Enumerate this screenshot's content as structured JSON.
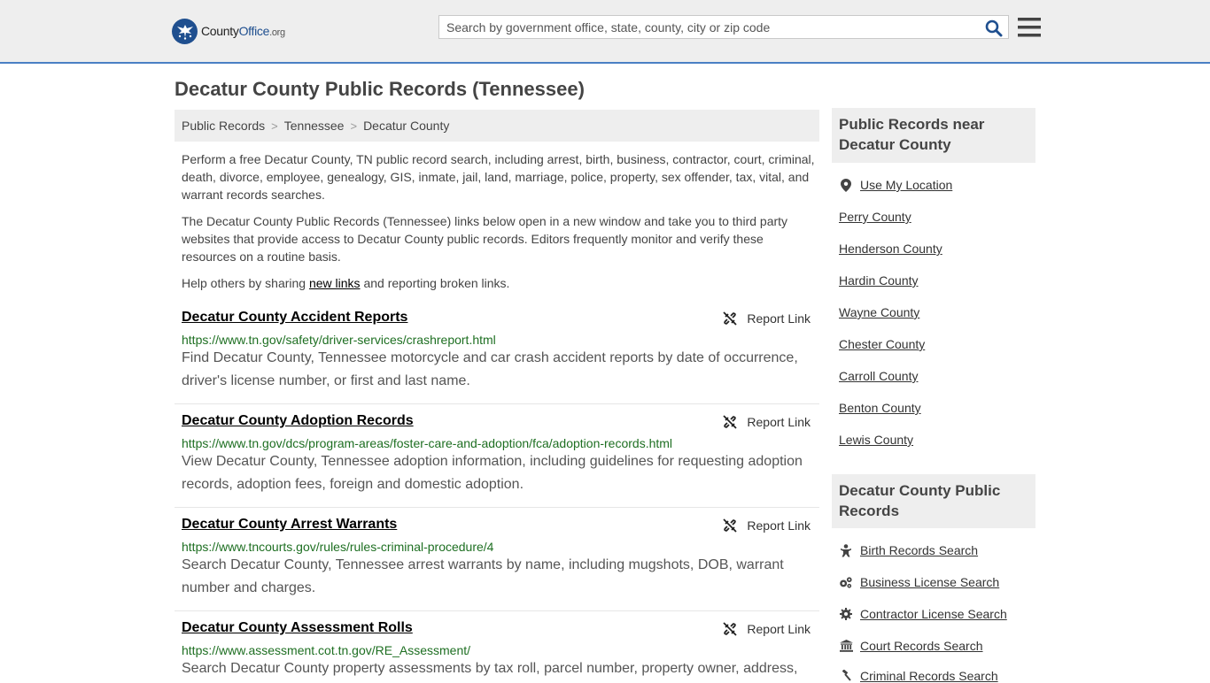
{
  "header": {
    "logo_name": "County",
    "logo_name2": "Office",
    "logo_suffix": ".org",
    "search_placeholder": "Search by government office, state, county, city or zip code"
  },
  "page": {
    "title": "Decatur County Public Records (Tennessee)",
    "breadcrumb": [
      "Public Records",
      "Tennessee",
      "Decatur County"
    ],
    "intro1": "Perform a free Decatur County, TN public record search, including arrest, birth, business, contractor, court, criminal, death, divorce, employee, genealogy, GIS, inmate, jail, land, marriage, police, property, sex offender, tax, vital, and warrant records searches.",
    "intro2": "The Decatur County Public Records (Tennessee) links below open in a new window and take you to third party websites that provide access to Decatur County public records. Editors frequently monitor and verify these resources on a routine basis.",
    "help_prefix": "Help others by sharing ",
    "help_link": "new links",
    "help_suffix": " and reporting broken links."
  },
  "records": [
    {
      "title": "Decatur County Accident Reports",
      "url": "https://www.tn.gov/safety/driver-services/crashreport.html",
      "desc": "Find Decatur County, Tennessee motorcycle and car crash accident reports by date of occurrence, driver's license number, or first and last name.",
      "report": "Report Link"
    },
    {
      "title": "Decatur County Adoption Records",
      "url": "https://www.tn.gov/dcs/program-areas/foster-care-and-adoption/fca/adoption-records.html",
      "desc": "View Decatur County, Tennessee adoption information, including guidelines for requesting adoption records, adoption fees, foreign and domestic adoption.",
      "report": "Report Link"
    },
    {
      "title": "Decatur County Arrest Warrants",
      "url": "https://www.tncourts.gov/rules/rules-criminal-procedure/4",
      "desc": "Search Decatur County, Tennessee arrest warrants by name, including mugshots, DOB, warrant number and charges.",
      "report": "Report Link"
    },
    {
      "title": "Decatur County Assessment Rolls",
      "url": "https://www.assessment.cot.tn.gov/RE_Assessment/",
      "desc": "Search Decatur County property assessments by tax roll, parcel number, property owner, address,",
      "report": "Report Link"
    }
  ],
  "sidebar": {
    "nearby_title": "Public Records near Decatur County",
    "use_location": "Use My Location",
    "nearby": [
      "Perry County",
      "Henderson County",
      "Hardin County",
      "Wayne County",
      "Chester County",
      "Carroll County",
      "Benton County",
      "Lewis County"
    ],
    "county_title": "Decatur County Public Records",
    "links": [
      "Birth Records Search",
      "Business License Search",
      "Contractor License Search",
      "Court Records Search",
      "Criminal Records Search"
    ],
    "link_icons": [
      "baby-icon",
      "gears-icon",
      "gear-icon",
      "courthouse-icon",
      "gavel-icon"
    ]
  },
  "colors": {
    "accent": "#4a80c4",
    "url_green": "#1e6f22",
    "logo_blue": "#1f4f8f"
  }
}
